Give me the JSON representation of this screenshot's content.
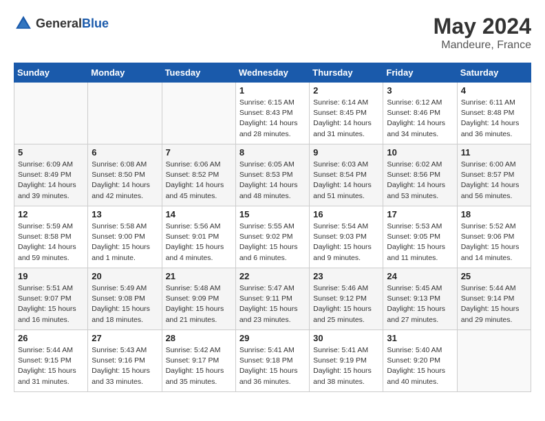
{
  "header": {
    "logo_general": "General",
    "logo_blue": "Blue",
    "title": "May 2024",
    "location": "Mandeure, France"
  },
  "days_of_week": [
    "Sunday",
    "Monday",
    "Tuesday",
    "Wednesday",
    "Thursday",
    "Friday",
    "Saturday"
  ],
  "weeks": [
    [
      {
        "day": "",
        "detail": ""
      },
      {
        "day": "",
        "detail": ""
      },
      {
        "day": "",
        "detail": ""
      },
      {
        "day": "1",
        "detail": "Sunrise: 6:15 AM\nSunset: 8:43 PM\nDaylight: 14 hours\nand 28 minutes."
      },
      {
        "day": "2",
        "detail": "Sunrise: 6:14 AM\nSunset: 8:45 PM\nDaylight: 14 hours\nand 31 minutes."
      },
      {
        "day": "3",
        "detail": "Sunrise: 6:12 AM\nSunset: 8:46 PM\nDaylight: 14 hours\nand 34 minutes."
      },
      {
        "day": "4",
        "detail": "Sunrise: 6:11 AM\nSunset: 8:48 PM\nDaylight: 14 hours\nand 36 minutes."
      }
    ],
    [
      {
        "day": "5",
        "detail": "Sunrise: 6:09 AM\nSunset: 8:49 PM\nDaylight: 14 hours\nand 39 minutes."
      },
      {
        "day": "6",
        "detail": "Sunrise: 6:08 AM\nSunset: 8:50 PM\nDaylight: 14 hours\nand 42 minutes."
      },
      {
        "day": "7",
        "detail": "Sunrise: 6:06 AM\nSunset: 8:52 PM\nDaylight: 14 hours\nand 45 minutes."
      },
      {
        "day": "8",
        "detail": "Sunrise: 6:05 AM\nSunset: 8:53 PM\nDaylight: 14 hours\nand 48 minutes."
      },
      {
        "day": "9",
        "detail": "Sunrise: 6:03 AM\nSunset: 8:54 PM\nDaylight: 14 hours\nand 51 minutes."
      },
      {
        "day": "10",
        "detail": "Sunrise: 6:02 AM\nSunset: 8:56 PM\nDaylight: 14 hours\nand 53 minutes."
      },
      {
        "day": "11",
        "detail": "Sunrise: 6:00 AM\nSunset: 8:57 PM\nDaylight: 14 hours\nand 56 minutes."
      }
    ],
    [
      {
        "day": "12",
        "detail": "Sunrise: 5:59 AM\nSunset: 8:58 PM\nDaylight: 14 hours\nand 59 minutes."
      },
      {
        "day": "13",
        "detail": "Sunrise: 5:58 AM\nSunset: 9:00 PM\nDaylight: 15 hours\nand 1 minute."
      },
      {
        "day": "14",
        "detail": "Sunrise: 5:56 AM\nSunset: 9:01 PM\nDaylight: 15 hours\nand 4 minutes."
      },
      {
        "day": "15",
        "detail": "Sunrise: 5:55 AM\nSunset: 9:02 PM\nDaylight: 15 hours\nand 6 minutes."
      },
      {
        "day": "16",
        "detail": "Sunrise: 5:54 AM\nSunset: 9:03 PM\nDaylight: 15 hours\nand 9 minutes."
      },
      {
        "day": "17",
        "detail": "Sunrise: 5:53 AM\nSunset: 9:05 PM\nDaylight: 15 hours\nand 11 minutes."
      },
      {
        "day": "18",
        "detail": "Sunrise: 5:52 AM\nSunset: 9:06 PM\nDaylight: 15 hours\nand 14 minutes."
      }
    ],
    [
      {
        "day": "19",
        "detail": "Sunrise: 5:51 AM\nSunset: 9:07 PM\nDaylight: 15 hours\nand 16 minutes."
      },
      {
        "day": "20",
        "detail": "Sunrise: 5:49 AM\nSunset: 9:08 PM\nDaylight: 15 hours\nand 18 minutes."
      },
      {
        "day": "21",
        "detail": "Sunrise: 5:48 AM\nSunset: 9:09 PM\nDaylight: 15 hours\nand 21 minutes."
      },
      {
        "day": "22",
        "detail": "Sunrise: 5:47 AM\nSunset: 9:11 PM\nDaylight: 15 hours\nand 23 minutes."
      },
      {
        "day": "23",
        "detail": "Sunrise: 5:46 AM\nSunset: 9:12 PM\nDaylight: 15 hours\nand 25 minutes."
      },
      {
        "day": "24",
        "detail": "Sunrise: 5:45 AM\nSunset: 9:13 PM\nDaylight: 15 hours\nand 27 minutes."
      },
      {
        "day": "25",
        "detail": "Sunrise: 5:44 AM\nSunset: 9:14 PM\nDaylight: 15 hours\nand 29 minutes."
      }
    ],
    [
      {
        "day": "26",
        "detail": "Sunrise: 5:44 AM\nSunset: 9:15 PM\nDaylight: 15 hours\nand 31 minutes."
      },
      {
        "day": "27",
        "detail": "Sunrise: 5:43 AM\nSunset: 9:16 PM\nDaylight: 15 hours\nand 33 minutes."
      },
      {
        "day": "28",
        "detail": "Sunrise: 5:42 AM\nSunset: 9:17 PM\nDaylight: 15 hours\nand 35 minutes."
      },
      {
        "day": "29",
        "detail": "Sunrise: 5:41 AM\nSunset: 9:18 PM\nDaylight: 15 hours\nand 36 minutes."
      },
      {
        "day": "30",
        "detail": "Sunrise: 5:41 AM\nSunset: 9:19 PM\nDaylight: 15 hours\nand 38 minutes."
      },
      {
        "day": "31",
        "detail": "Sunrise: 5:40 AM\nSunset: 9:20 PM\nDaylight: 15 hours\nand 40 minutes."
      },
      {
        "day": "",
        "detail": ""
      }
    ]
  ]
}
